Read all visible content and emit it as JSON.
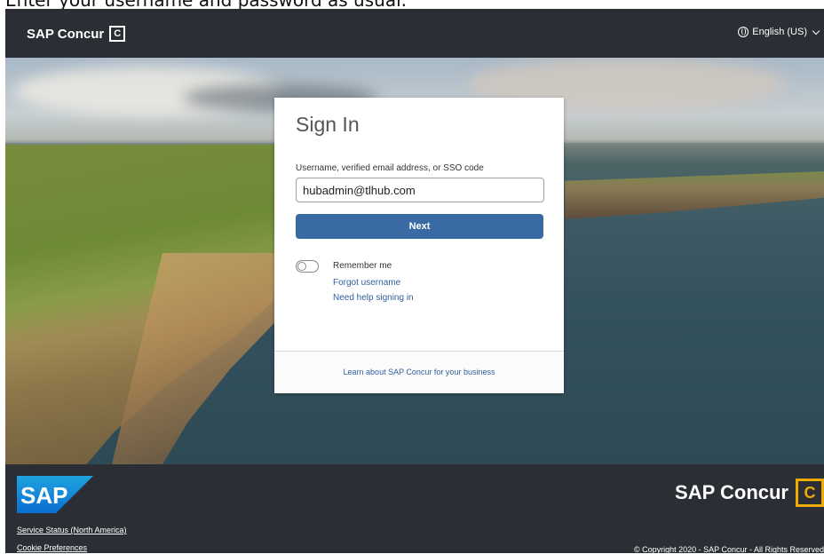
{
  "caption": "Enter your username and password as usual.",
  "header": {
    "brand": "SAP Concur",
    "brand_mark": "C",
    "language": "English (US)"
  },
  "signin": {
    "title": "Sign In",
    "username_label": "Username, verified email address, or SSO code",
    "username_value": "hubadmin@tlhub.com",
    "next_label": "Next",
    "remember_label": "Remember me",
    "remember_on": false,
    "forgot_username": "Forgot username",
    "need_help": "Need help signing in",
    "learn_more": "Learn about SAP Concur for your business"
  },
  "footer": {
    "sap_logo_text": "SAP",
    "service_status": "Service Status (North America)",
    "cookie_prefs": "Cookie Preferences",
    "brand": "SAP Concur",
    "brand_mark": "C",
    "copyright": "© Copyright 2020 - SAP Concur - All Rights Reserved"
  },
  "colors": {
    "header_bg": "#2b2e34",
    "primary_button": "#3a6aa4",
    "link": "#2f5f9e",
    "accent": "#f0ab00"
  },
  "icons": [
    "globe-icon",
    "chevron-down-icon",
    "toggle-switch",
    "sap-logo"
  ]
}
